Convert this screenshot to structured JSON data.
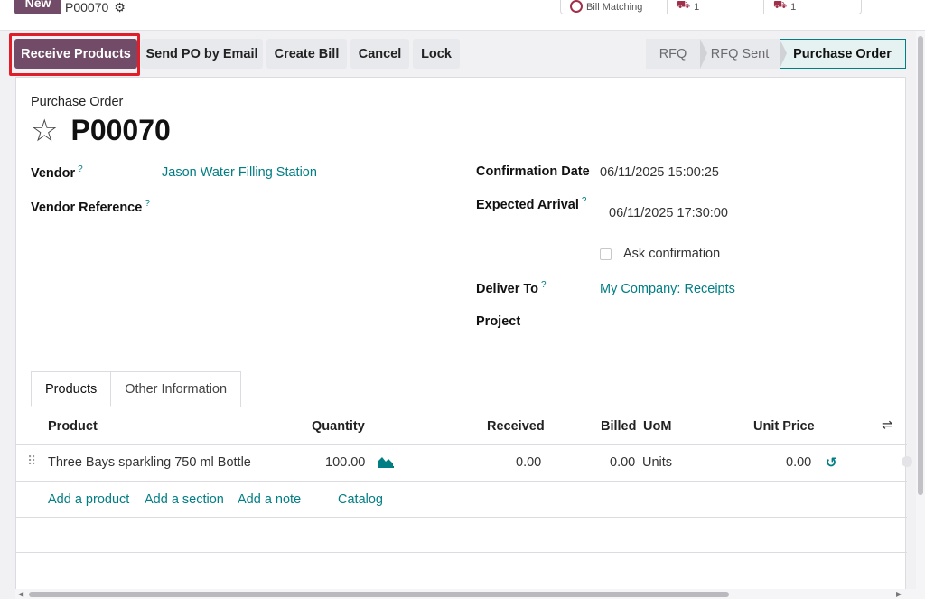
{
  "top": {
    "new_label": "New",
    "record_name": "P00070",
    "smart_buttons": [
      {
        "label": "Bill Matching",
        "icon": "bill-icon"
      },
      {
        "label": "1",
        "icon": "truck-icon"
      },
      {
        "label": "1",
        "icon": "truck-icon"
      }
    ]
  },
  "actions": {
    "receive_products": "Receive Products",
    "send_po_email": "Send PO by Email",
    "create_bill": "Create Bill",
    "cancel": "Cancel",
    "lock": "Lock"
  },
  "stages": [
    "RFQ",
    "RFQ Sent",
    "Purchase Order"
  ],
  "form": {
    "doc_type": "Purchase Order",
    "title": "P00070",
    "vendor_label": "Vendor",
    "vendor_value": "Jason Water Filling Station",
    "vendor_ref_label": "Vendor Reference",
    "confirmation_date_label": "Confirmation Date",
    "confirmation_date_value": "06/11/2025 15:00:25",
    "expected_arrival_label": "Expected Arrival",
    "expected_arrival_value": "06/11/2025 17:30:00",
    "ask_confirmation_label": "Ask confirmation",
    "deliver_to_label": "Deliver To",
    "deliver_to_value": "My Company: Receipts",
    "project_label": "Project",
    "help_mark": "?"
  },
  "tabs": [
    "Products",
    "Other Information"
  ],
  "table": {
    "headers": {
      "product": "Product",
      "quantity": "Quantity",
      "received": "Received",
      "billed": "Billed",
      "uom": "UoM",
      "unit_price": "Unit Price"
    },
    "rows": [
      {
        "product": "Three Bays sparkling 750 ml Bottle",
        "quantity": "100.00",
        "received": "0.00",
        "billed": "0.00",
        "uom": "Units",
        "unit_price": "0.00"
      }
    ],
    "add_links": {
      "add_product": "Add a product",
      "add_section": "Add a section",
      "add_note": "Add a note",
      "catalog": "Catalog"
    }
  },
  "colors": {
    "primary": "#714B67",
    "link": "#017e84",
    "highlight": "#e11d2a"
  }
}
